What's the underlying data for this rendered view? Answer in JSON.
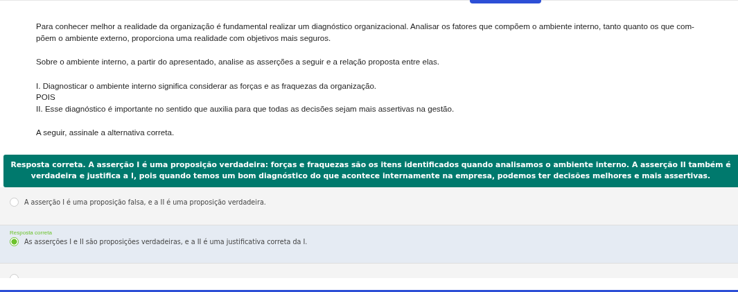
{
  "question": {
    "paragraphs": [
      [
        "Para conhecer melhor a realidade da organização é fundamental realizar um diagnóstico organizacional. Analisar os fatores que compõem o ambiente interno, tanto quanto os que com-",
        "põem o ambiente externo, proporciona uma realidade com objetivos mais seguros."
      ],
      [
        "Sobre o ambiente interno, a partir do apresentado, analise as asserções a seguir e a relação proposta entre elas."
      ],
      [
        "I. Diagnosticar o ambiente interno significa considerar as forças e as fraquezas da organização.",
        "POIS",
        "II. Esse diagnóstico é importante no sentido que auxilia para que todas as decisões sejam mais assertivas na gestão."
      ],
      [
        "A seguir, assinale a alternativa correta."
      ]
    ]
  },
  "feedback": "Resposta correta. A asserção I é uma proposição verdadeira: forças e fraquezas são os itens identificados quando analisamos o ambiente interno. A asserção II também é verdadeira e justifica a I, pois quando temos um bom diagnóstico do que acontece internamente na empresa, podemos ter decisões melhores e mais assertivas.",
  "options": [
    {
      "label": "A asserção I é uma proposição falsa, e a II é uma proposição verdadeira.",
      "selected": false
    },
    {
      "tag": "Resposta correta",
      "label": "As asserções I e II são proposições verdadeiras, e a II é uma justificativa correta da I.",
      "selected": true
    },
    {
      "selected": false
    }
  ]
}
